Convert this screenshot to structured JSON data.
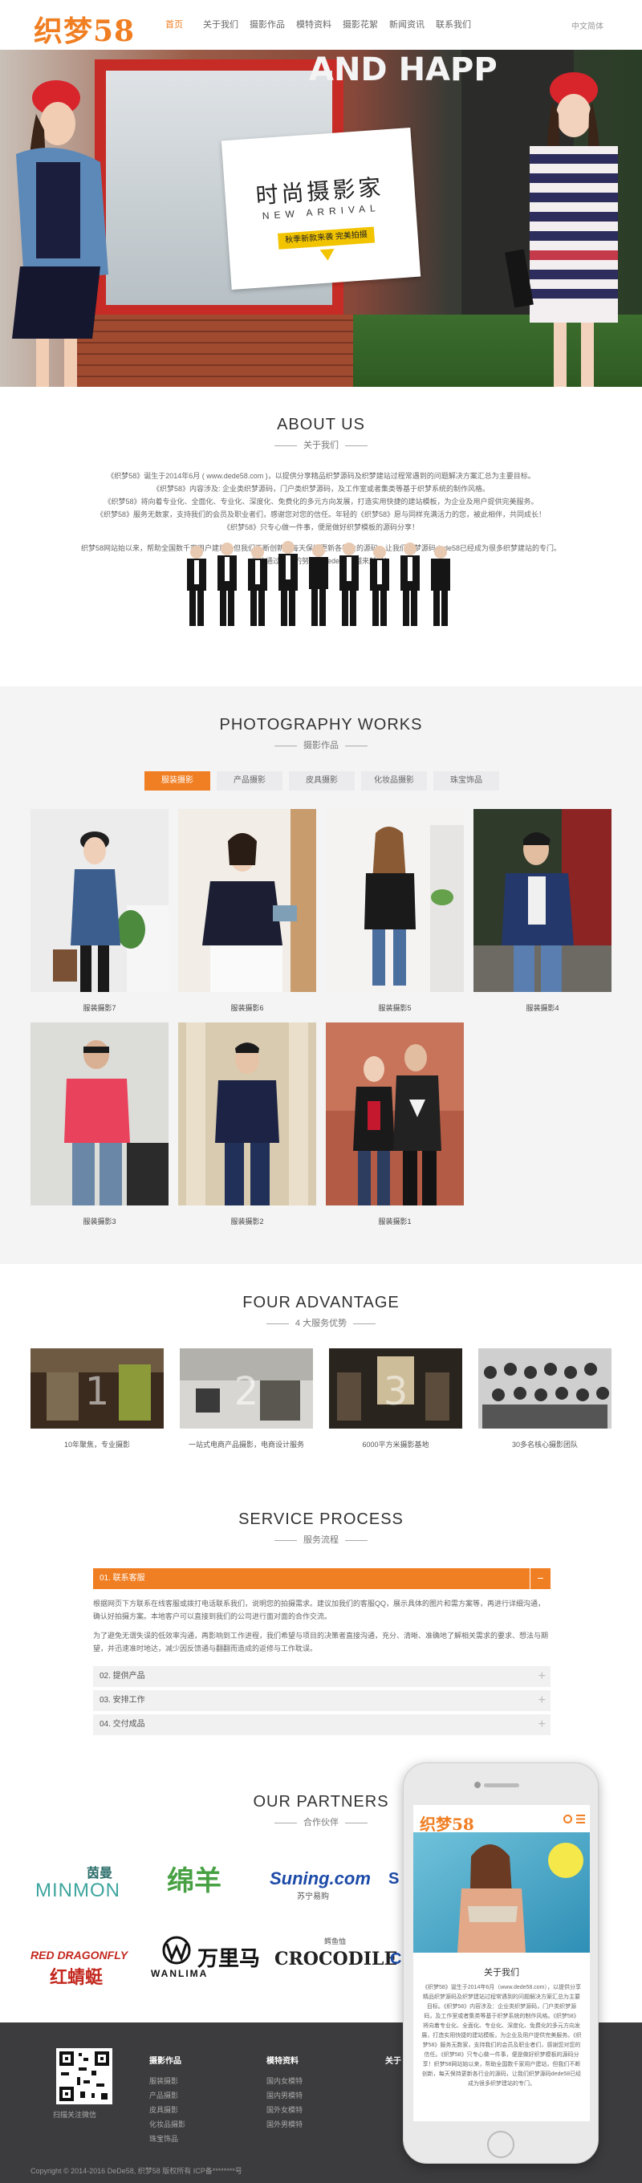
{
  "header": {
    "logo": "织梦58",
    "nav": [
      "首页",
      "关于我们",
      "摄影作品",
      "模特资料",
      "摄影花絮",
      "新闻资讯",
      "联系我们"
    ],
    "language": "中文简体"
  },
  "banner": {
    "sign": "AND HAPP",
    "title": "时尚摄影家",
    "subtitle": "NEW ARRIVAL",
    "tag": "秋季新款来袭 完美拍摄"
  },
  "about": {
    "title": "ABOUT US",
    "subtitle": "关于我们",
    "paragraphs": [
      "《织梦58》诞生于2014年6月 ( www.dede58.com )，以提供分享精品织梦源码及织梦建站过程常遇到的问题解决方案汇总为主要目标。",
      "《织梦58》内容涉及: 企业类织梦源码，门户类织梦源码，及工作室或者集类等基于织梦系统的制作风格。",
      "《织梦58》将向着专业化、全面化、专业化、深度化、免费化的多元方向发展，打造实用快捷的建站模板，为企业及用户提供完美服务。",
      "《织梦58》服务无数家，支持我们的会员及职业者们，感谢您对您的信任。年轻的《织梦58》愿与同样充满活力的您，被此相伴，共同成长！",
      "《织梦58》只专心做一件事，便是做好织梦模板的源码分享！"
    ],
    "mission": [
      "织梦58网站始以来，帮助全国数千家用户建站，但我们不断创新，每天保持更新各行业的源码，让我们织梦源码dede58已经成为很多织梦建站的专门。",
      "相信通过我们的努力，dede58会越来越好！"
    ]
  },
  "works": {
    "title": "PHOTOGRAPHY WORKS",
    "subtitle": "摄影作品",
    "tabs": [
      "服装摄影",
      "产品摄影",
      "皮具摄影",
      "化妆品摄影",
      "珠宝饰品"
    ],
    "items": [
      "服装摄影7",
      "服装摄影6",
      "服装摄影5",
      "服装摄影4",
      "服装摄影3",
      "服装摄影2",
      "服装摄影1"
    ]
  },
  "advantage": {
    "title": "FOUR ADVANTAGE",
    "subtitle": "4 大服务优势",
    "items": [
      "10年聚焦，专业摄影",
      "一站式电商产品摄影，电商设计服务",
      "6000平方米摄影基地",
      "30多名核心摄影团队"
    ]
  },
  "process": {
    "title": "SERVICE PROCESS",
    "subtitle": "服务流程",
    "steps": [
      "01. 联系客服",
      "02. 提供产品",
      "03. 安排工作",
      "04. 交付成品"
    ],
    "step1_p1": "根据网页下方联系在线客服或拨打电话联系我们，说明您的拍摄需求。建议加我们的客服QQ，展示具体的图片和需方案等，再进行详细沟通，确认好拍摄方案。本地客户可以直接到我们的公司进行面对面的合作交流。",
    "step1_p2": "为了避免无谓失误的低效率沟通，再影响到工作进程，我们希望与项目的决策者直接沟通，充分、清晰、准确地了解相关需求的要求、想法与期望，并迅速准时地达，减少因反馈通与翻翻而造成的返修与工作耽误。"
  },
  "partners": {
    "title": "OUR PARTNERS",
    "subtitle": "合作伙伴",
    "logos": [
      "茵曼",
      "MINMON",
      "绵羊",
      "Suning.com",
      "苏宁易购",
      "RED DRAGONFLY",
      "红蜻蜓",
      "万里马",
      "WANLIMA",
      "鳄鱼恤",
      "CROCODILE"
    ]
  },
  "footer": {
    "qr_caption": "扫描关注微信",
    "col1_title": "摄影作品",
    "col1": [
      "服装摄影",
      "产品摄影",
      "皮具摄影",
      "化妆品摄影",
      "珠宝饰品"
    ],
    "col2_title": "模特资料",
    "col2": [
      "国内女模特",
      "国内男模特",
      "国外女模特",
      "国外男模特"
    ],
    "col3_title": "关于",
    "copyright": "Copyright © 2014-2016 DeDe58, 织梦58 版权所有  ICP备********号"
  },
  "mobile": {
    "logo": "织梦58",
    "title": "关于我们",
    "text": "《织梦58》诞生于2014年6月（www.dede58.com），以提供分享精品织梦源码及织梦建站过程常遇到的问题解决方案汇总为主要目标。《织梦58》内容涉及：企业类织梦源码，门户类织梦源码，及工作室或者集类等基于织梦系统的制作风格。《织梦58》将向着专业化、全面化、专业化、深度化、免费化的多元方向发展，打造实用快捷的建站模板，为企业及用户提供完美服务。《织梦58》服务无数家，支持我们的会员及职业者们，感谢您对您的信任。《织梦58》只专心做一件事，便是做好织梦模板的源码分享！织梦58网站始以来，帮助全国数千家用户建站，但我们不断创新，每天保持更新各行业的源码，让我们织梦源码dede58已经成为很多织梦建站的专门。"
  },
  "colors": {
    "accent": "#f07e22",
    "footer_bg": "#3c3c3e",
    "section_gray": "#f4f4f5"
  }
}
